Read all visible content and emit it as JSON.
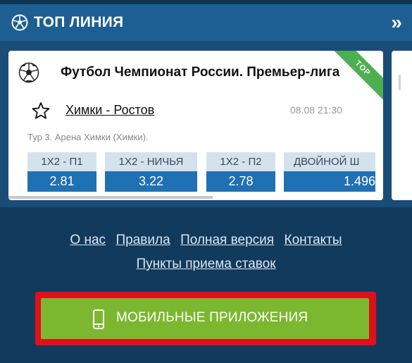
{
  "header": {
    "title": "ТОП ЛИНИЯ",
    "icon": "soccer-ball-icon",
    "expand_icon": "double-chevron-right-icon"
  },
  "event": {
    "league": "Футбол Чемпионат России. Премьер-лига",
    "badge": "TOP",
    "match": "Химки - Ростов",
    "datetime": "08.08 21:30",
    "round_info": "Тур 3. Арена Химки (Химки).",
    "odds": [
      {
        "label": "1X2 - П1",
        "value": "2.81"
      },
      {
        "label": "1X2 - НИЧЬЯ",
        "value": "3.22"
      },
      {
        "label": "1X2 - П2",
        "value": "2.78"
      },
      {
        "label": "ДВОЙНОЙ Ш",
        "value": "1.496"
      }
    ]
  },
  "footer_links": {
    "about": "О нас",
    "rules": "Правила",
    "full_version": "Полная версия",
    "contacts": "Контакты",
    "bet_points": "Пункты приема ставок"
  },
  "mobile_apps_button": "МОБИЛЬНЫЕ ПРИЛОЖЕНИЯ",
  "colors": {
    "header": "#1d5f92",
    "background": "#123a5c",
    "odds_value": "#2071b3",
    "app_button": "#7cb82f",
    "highlight_border": "#e0101a"
  }
}
